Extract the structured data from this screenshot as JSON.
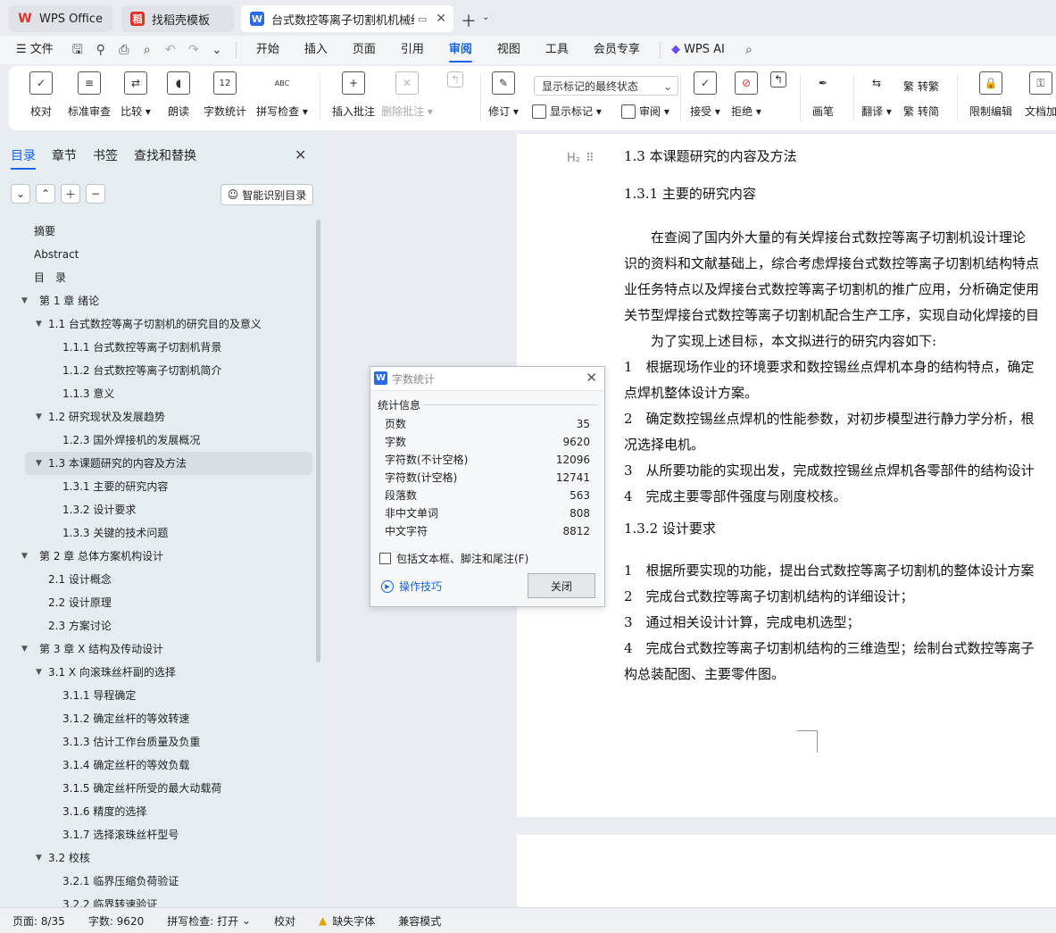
{
  "tabs": [
    {
      "label": "WPS Office",
      "icon": "wps-logo-icon"
    },
    {
      "label": "找稻壳模板",
      "icon": "docer-icon"
    },
    {
      "label": "台式数控等离子切割机机械结",
      "icon": "word-doc-icon"
    }
  ],
  "menubar": {
    "file": "文件",
    "items": [
      "开始",
      "插入",
      "页面",
      "引用",
      "审阅",
      "视图",
      "工具",
      "会员专享"
    ],
    "active": "审阅",
    "wps_ai": "WPS AI"
  },
  "ribbon": {
    "proofread": "校对",
    "standard_review": "标准审查",
    "compare": "比较",
    "read_aloud": "朗读",
    "word_count": "字数统计",
    "spell_check": "拼写检查",
    "insert_comment": "插入批注",
    "delete_comment": "删除批注",
    "track_changes": "修订",
    "markup_select": "显示标记的最终状态",
    "show_markup": "显示标记",
    "review": "审阅",
    "accept": "接受",
    "reject": "拒绝",
    "pen": "画笔",
    "translate": "翻译",
    "to_traditional": "转繁",
    "to_simplified": "转简",
    "restrict_edit": "限制编辑",
    "doc_encrypt": "文档加"
  },
  "nav": {
    "tabs": [
      "目录",
      "章节",
      "书签",
      "查找和替换"
    ],
    "smart_toc": "智能识别目录",
    "toc": [
      {
        "label": "摘要",
        "level": 0,
        "toggle": ""
      },
      {
        "label": "Abstract",
        "level": 0,
        "toggle": ""
      },
      {
        "label": "目　录",
        "level": 0,
        "toggle": ""
      },
      {
        "label": "第 1 章  绪论",
        "level": 0,
        "toggle": "▼"
      },
      {
        "label": "1.1 台式数控等离子切割机的研究目的及意义",
        "level": 1,
        "toggle": "▼"
      },
      {
        "label": "1.1.1 台式数控等离子切割机背景",
        "level": 2,
        "toggle": ""
      },
      {
        "label": "1.1.2 台式数控等离子切割机简介",
        "level": 2,
        "toggle": ""
      },
      {
        "label": "1.1.3 意义",
        "level": 2,
        "toggle": ""
      },
      {
        "label": "1.2 研究现状及发展趋势",
        "level": 1,
        "toggle": "▼"
      },
      {
        "label": "1.2.3 国外焊接机的发展概况",
        "level": 2,
        "toggle": ""
      },
      {
        "label": "1.3 本课题研究的内容及方法",
        "level": 1,
        "toggle": "▼",
        "selected": true
      },
      {
        "label": "1.3.1 主要的研究内容",
        "level": 2,
        "toggle": ""
      },
      {
        "label": "1.3.2 设计要求",
        "level": 2,
        "toggle": ""
      },
      {
        "label": "1.3.3 关键的技术问题",
        "level": 2,
        "toggle": ""
      },
      {
        "label": "第 2 章  总体方案机构设计",
        "level": 0,
        "toggle": "▼"
      },
      {
        "label": "2.1 设计概念",
        "level": 1,
        "toggle": ""
      },
      {
        "label": "2.2 设计原理",
        "level": 1,
        "toggle": ""
      },
      {
        "label": "2.3 方案讨论",
        "level": 1,
        "toggle": ""
      },
      {
        "label": "第 3 章  X 结构及传动设计",
        "level": 0,
        "toggle": "▼"
      },
      {
        "label": "3.1 X 向滚珠丝杆副的选择",
        "level": 1,
        "toggle": "▼"
      },
      {
        "label": "3.1.1 导程确定",
        "level": 2,
        "toggle": ""
      },
      {
        "label": "3.1.2 确定丝杆的等效转速",
        "level": 2,
        "toggle": ""
      },
      {
        "label": "3.1.3 估计工作台质量及负重",
        "level": 2,
        "toggle": ""
      },
      {
        "label": "3.1.4 确定丝杆的等效负载",
        "level": 2,
        "toggle": ""
      },
      {
        "label": "3.1.5 确定丝杆所受的最大动载荷",
        "level": 2,
        "toggle": ""
      },
      {
        "label": "3.1.6 精度的选择",
        "level": 2,
        "toggle": ""
      },
      {
        "label": "3.1.7 选择滚珠丝杆型号",
        "level": 2,
        "toggle": ""
      },
      {
        "label": "3.2 校核",
        "level": 1,
        "toggle": "▼"
      },
      {
        "label": "3.2.1  临界压缩负荷验证",
        "level": 2,
        "toggle": ""
      },
      {
        "label": "3.2.2  临界转速验证",
        "level": 2,
        "toggle": ""
      }
    ]
  },
  "document": {
    "heading_marker": "H₂",
    "lines": [
      "1.3 本课题研究的内容及方法",
      "1.3.1 主要的研究内容",
      "　　在查阅了国内外大量的有关焊接台式数控等离子切割机设计理论",
      "识的资料和文献基础上，综合考虑焊接台式数控等离子切割机结构特点",
      "业任务特点以及焊接台式数控等离子切割机的推广应用，分析确定使用",
      "关节型焊接台式数控等离子切割机配合生产工序，实现自动化焊接的目",
      "　　为了实现上述目标，本文拟进行的研究内容如下:",
      "1　根据现场作业的环境要求和数控锡丝点焊机本身的结构特点，确定",
      "点焊机整体设计方案。",
      "2　确定数控锡丝点焊机的性能参数，对初步模型进行静力学分析，根",
      "况选择电机。",
      "3　从所要功能的实现出发，完成数控锡丝点焊机各零部件的结构设计",
      "4　完成主要零部件强度与刚度校核。",
      "1.3.2 设计要求",
      "1　根据所要实现的功能，提出台式数控等离子切割机的整体设计方案",
      "2　完成台式数控等离子切割机结构的详细设计；",
      "3　通过相关设计计算，完成电机选型；",
      "4　完成台式数控等离子切割机结构的三维造型；绘制台式数控等离子",
      "构总装配图、主要零件图。"
    ],
    "page_number": "8"
  },
  "dialog": {
    "title": "字数统计",
    "section": "统计信息",
    "stats": [
      {
        "label": "页数",
        "value": "35"
      },
      {
        "label": "字数",
        "value": "9620"
      },
      {
        "label": "字符数(不计空格)",
        "value": "12096"
      },
      {
        "label": "字符数(计空格)",
        "value": "12741"
      },
      {
        "label": "段落数",
        "value": "563"
      },
      {
        "label": "非中文单词",
        "value": "808"
      },
      {
        "label": "中文字符",
        "value": "8812"
      }
    ],
    "include_label": "包括文本框、脚注和尾注(F)",
    "tips": "操作技巧",
    "close": "关闭"
  },
  "status": {
    "page": "页面: 8/35",
    "words": "字数: 9620",
    "spell": "拼写检查: 打开",
    "proof": "校对",
    "missing_font": "缺失字体",
    "compat": "兼容模式"
  },
  "colors": {
    "accent": "#1662e8",
    "wps_red": "#e0312b"
  }
}
